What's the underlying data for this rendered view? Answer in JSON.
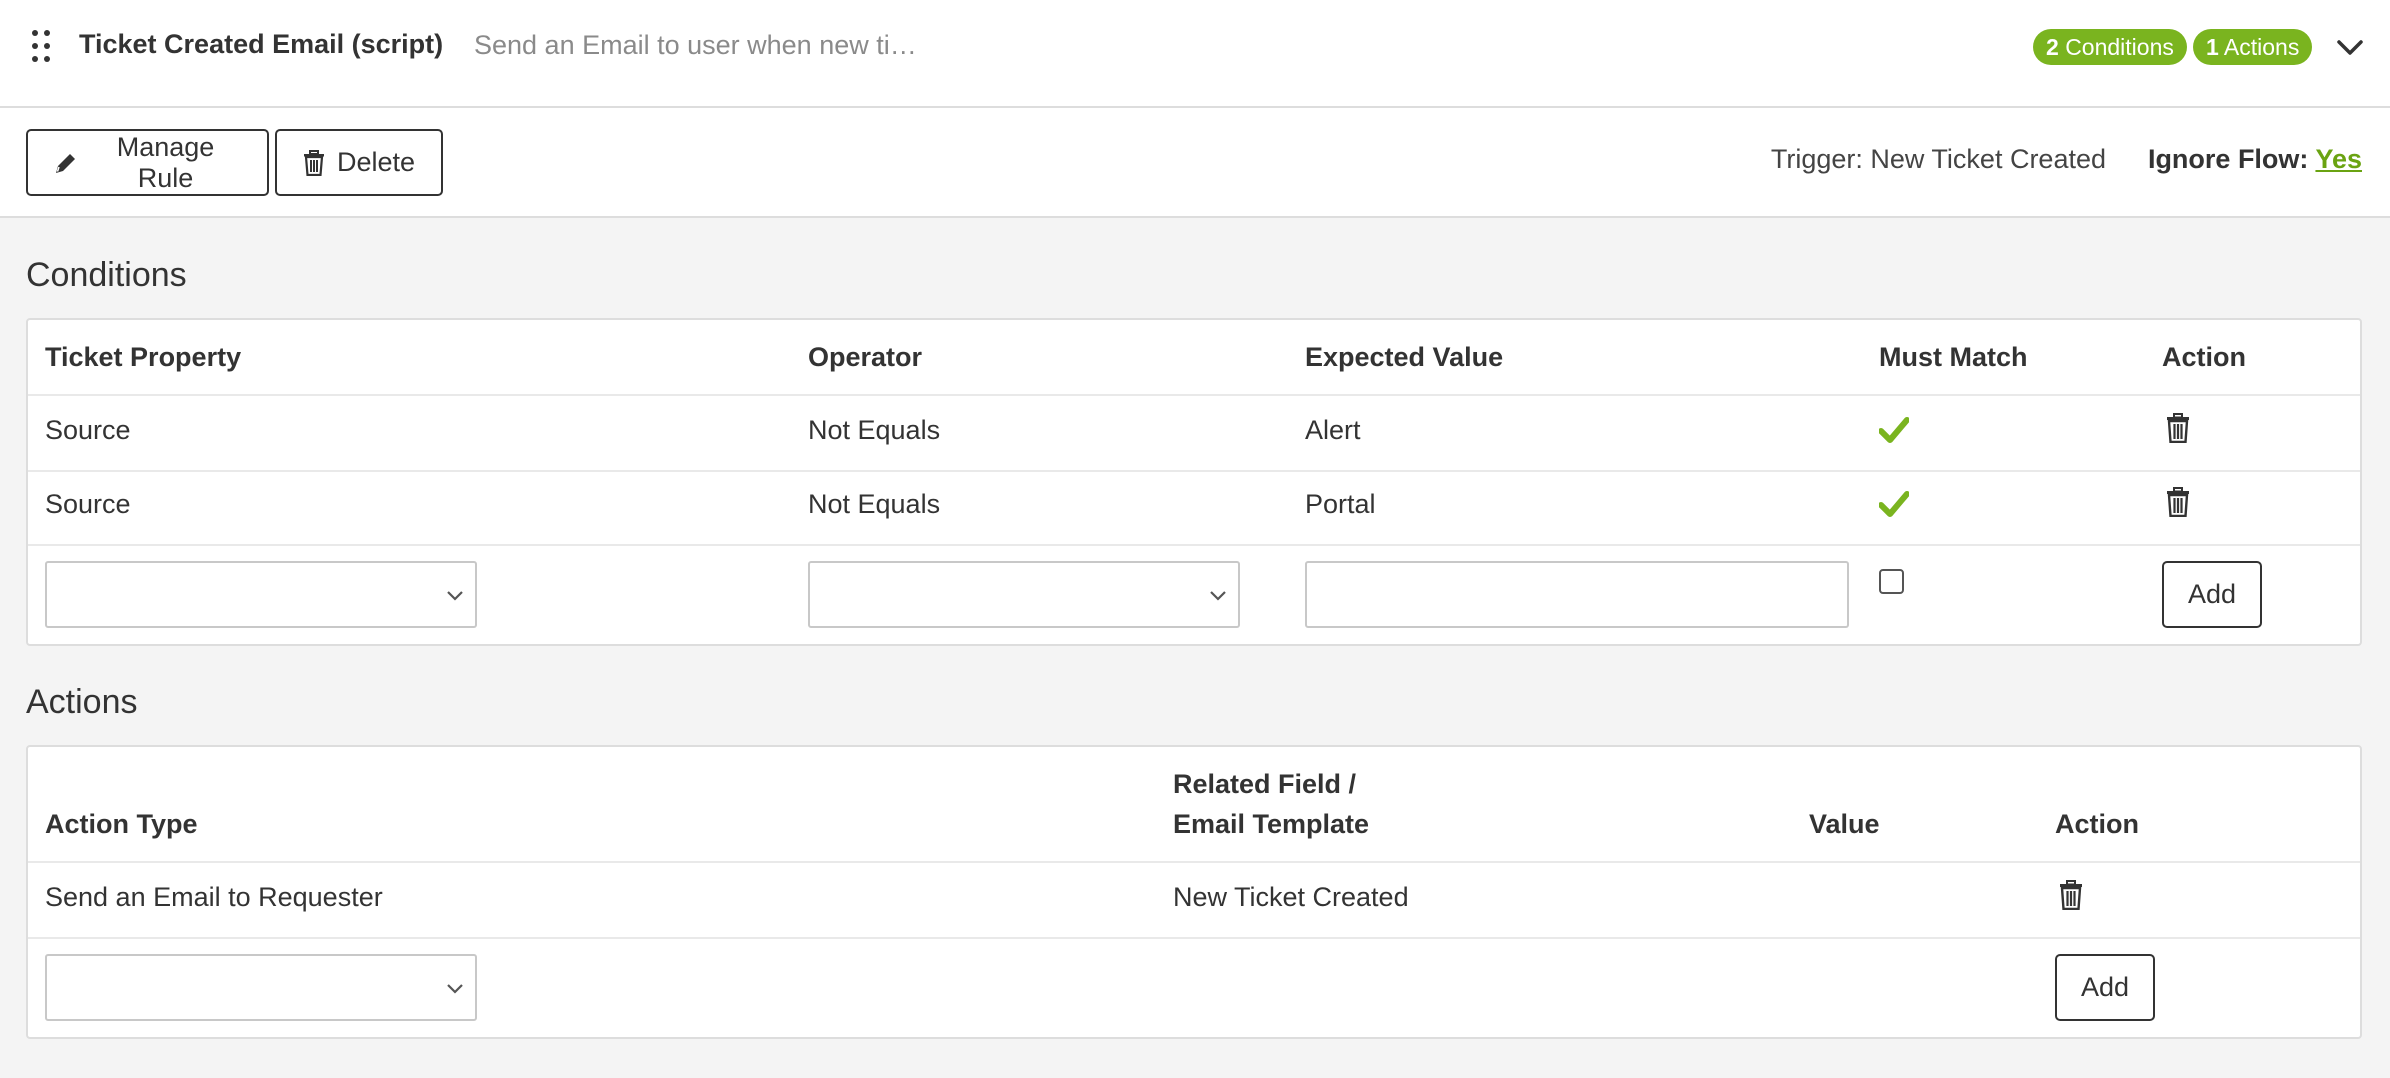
{
  "header": {
    "title": "Ticket Created Email (script)",
    "description": "Send an Email to user when new ti…",
    "conditions_badge": {
      "count": "2",
      "label": "Conditions"
    },
    "actions_badge": {
      "count": "1",
      "label": "Actions"
    }
  },
  "toolbar": {
    "manage_rule_label": "Manage Rule",
    "delete_label": "Delete",
    "trigger_label": "Trigger:",
    "trigger_value": "New Ticket Created",
    "ignore_flow_label": "Ignore Flow:",
    "ignore_flow_value": "Yes"
  },
  "conditions": {
    "title": "Conditions",
    "columns": [
      "Ticket Property",
      "Operator",
      "Expected Value",
      "Must Match",
      "Action"
    ],
    "rows": [
      {
        "property": "Source",
        "operator": "Not Equals",
        "value": "Alert",
        "must_match": true
      },
      {
        "property": "Source",
        "operator": "Not Equals",
        "value": "Portal",
        "must_match": true
      }
    ],
    "new_row": {
      "property_selected": "",
      "operator_selected": "",
      "value": "",
      "must_match": false,
      "add_label": "Add"
    }
  },
  "actions": {
    "title": "Actions",
    "columns": {
      "type": "Action Type",
      "related_line1": "Related Field /",
      "related_line2": "Email Template",
      "value": "Value",
      "action": "Action"
    },
    "rows": [
      {
        "type": "Send an Email to Requester",
        "related": "New Ticket Created",
        "value": ""
      }
    ],
    "new_row": {
      "type_selected": "",
      "add_label": "Add"
    }
  },
  "colors": {
    "accent": "#7ab41f",
    "link": "#6aa312",
    "check": "#7ab41f"
  },
  "icons": [
    "drag-handle-icon",
    "chevron-down-icon",
    "pencil-icon",
    "trash-icon",
    "checkmark-icon"
  ]
}
